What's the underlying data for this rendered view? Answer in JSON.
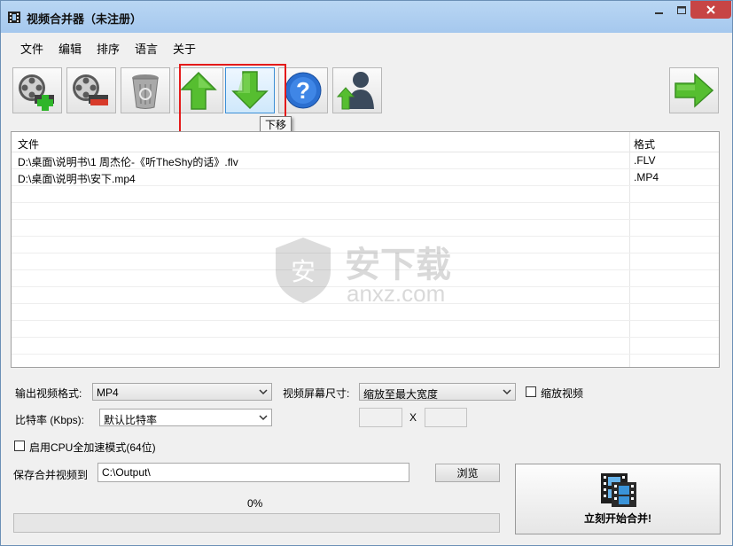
{
  "window": {
    "title": "视频合并器（未注册）"
  },
  "menu": [
    "文件",
    "编辑",
    "排序",
    "语言",
    "关于"
  ],
  "toolbar": {
    "tooltip": "下移",
    "buttons": [
      {
        "icon": "film-add-icon"
      },
      {
        "icon": "film-remove-icon"
      },
      {
        "icon": "recycle-bin-icon"
      },
      {
        "icon": "arrow-up-icon"
      },
      {
        "icon": "arrow-down-icon"
      },
      {
        "icon": "help-icon"
      },
      {
        "icon": "user-upload-icon"
      },
      {
        "icon": "arrow-right-icon"
      }
    ]
  },
  "file_list": {
    "headers": {
      "file": "文件",
      "format": "格式"
    },
    "rows": [
      {
        "file": "D:\\桌面\\说明书\\1 周杰伦-《听TheShy的话》.flv",
        "format": ".FLV"
      },
      {
        "file": "D:\\桌面\\说明书\\安下.mp4",
        "format": ".MP4"
      }
    ]
  },
  "watermark": {
    "brand": "安下载",
    "domain": "anxz.com",
    "shield_letter": "安"
  },
  "options": {
    "output_format_label": "输出视频格式:",
    "output_format_value": "MP4",
    "screen_size_label": "视频屏幕尺寸:",
    "screen_size_value": "缩放至最大宽度",
    "scale_video_label": "缩放视频",
    "bitrate_label": "比特率 (Kbps):",
    "bitrate_value": "默认比特率",
    "size_separator": "X",
    "cpu_accel_label": "启用CPU全加速模式(64位)"
  },
  "output": {
    "save_label": "保存合并视频到",
    "path": "C:\\Output\\",
    "browse_label": "浏览",
    "progress_text": "0%",
    "progress": 0
  },
  "merge_button": {
    "label": "立刻开始合并!"
  },
  "colors": {
    "titlebar": "#a5c8ee",
    "close": "#c74545",
    "arrow_green": "#4cb62e",
    "highlight": "#e41a1a",
    "progress": "#06b025"
  }
}
